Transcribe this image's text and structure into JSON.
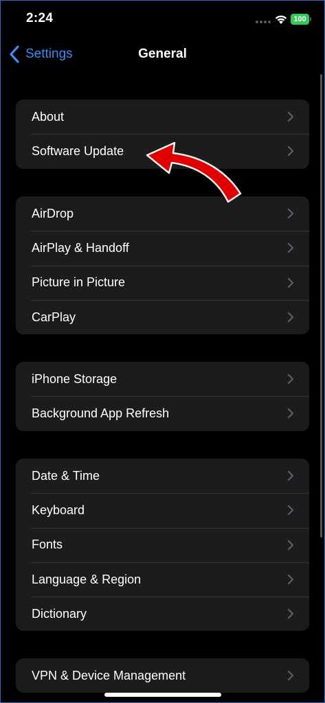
{
  "status_bar": {
    "time": "2:24",
    "battery": "100",
    "wifi_icon": "wifi-icon",
    "battery_color": "#34c759"
  },
  "nav": {
    "back_label": "Settings",
    "back_icon": "chevron-left-icon",
    "title": "General",
    "accent_color": "#3b8cf6"
  },
  "groups": [
    {
      "items": [
        {
          "label": "About"
        },
        {
          "label": "Software Update"
        }
      ]
    },
    {
      "items": [
        {
          "label": "AirDrop"
        },
        {
          "label": "AirPlay & Handoff"
        },
        {
          "label": "Picture in Picture"
        },
        {
          "label": "CarPlay"
        }
      ]
    },
    {
      "items": [
        {
          "label": "iPhone Storage"
        },
        {
          "label": "Background App Refresh"
        }
      ]
    },
    {
      "items": [
        {
          "label": "Date & Time"
        },
        {
          "label": "Keyboard"
        },
        {
          "label": "Fonts"
        },
        {
          "label": "Language & Region"
        },
        {
          "label": "Dictionary"
        }
      ]
    },
    {
      "items": [
        {
          "label": "VPN & Device Management"
        }
      ]
    }
  ],
  "annotation": {
    "icon": "red-arrow-icon",
    "color": "#e00000"
  }
}
